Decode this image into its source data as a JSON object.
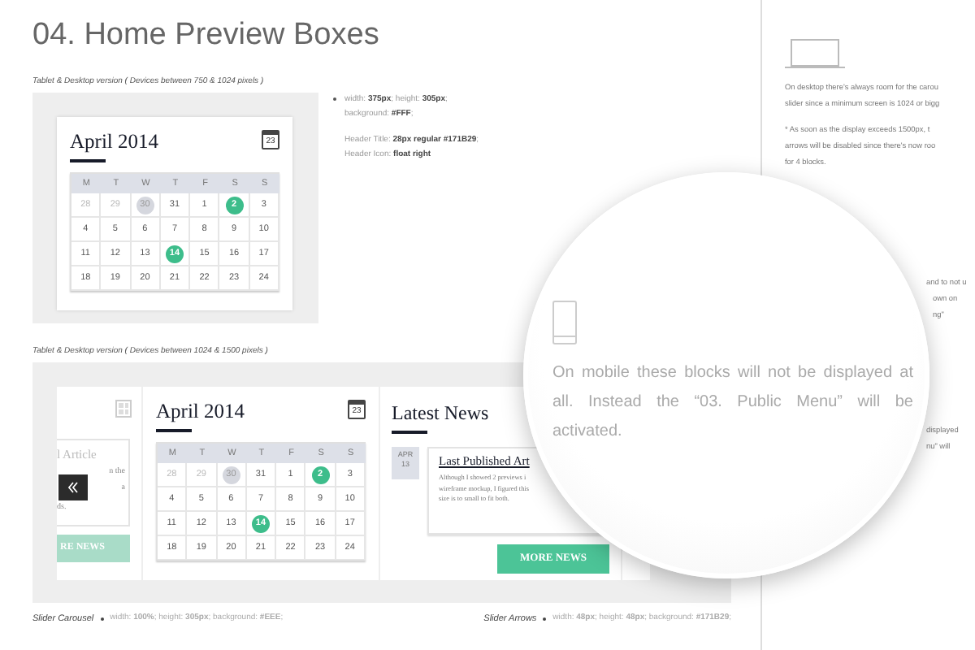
{
  "title": "04. Home Preview Boxes",
  "tablet_section": {
    "caption": "Tablet & Desktop version ( Devices between 750 & 1024 pixels )",
    "calendar": {
      "title": "April 2014",
      "icon_label": "23",
      "weekdays": [
        "M",
        "T",
        "W",
        "T",
        "F",
        "S",
        "S"
      ],
      "weeks": [
        [
          {
            "label": "28",
            "kind": "faded"
          },
          {
            "label": "29",
            "kind": "faded"
          },
          {
            "label": "30",
            "kind": "circled"
          },
          {
            "label": "31",
            "kind": "plain"
          },
          {
            "label": "1",
            "kind": "plain"
          },
          {
            "label": "2",
            "kind": "highlighted"
          },
          {
            "label": "3",
            "kind": "plain"
          }
        ],
        [
          {
            "label": "4",
            "kind": "plain"
          },
          {
            "label": "5",
            "kind": "plain"
          },
          {
            "label": "6",
            "kind": "plain"
          },
          {
            "label": "7",
            "kind": "plain"
          },
          {
            "label": "8",
            "kind": "plain"
          },
          {
            "label": "9",
            "kind": "plain"
          },
          {
            "label": "10",
            "kind": "plain"
          }
        ],
        [
          {
            "label": "11",
            "kind": "plain"
          },
          {
            "label": "12",
            "kind": "plain"
          },
          {
            "label": "13",
            "kind": "plain"
          },
          {
            "label": "14",
            "kind": "highlighted"
          },
          {
            "label": "15",
            "kind": "plain"
          },
          {
            "label": "16",
            "kind": "plain"
          },
          {
            "label": "17",
            "kind": "plain"
          }
        ],
        [
          {
            "label": "18",
            "kind": "plain"
          },
          {
            "label": "19",
            "kind": "plain"
          },
          {
            "label": "20",
            "kind": "plain"
          },
          {
            "label": "21",
            "kind": "plain"
          },
          {
            "label": "22",
            "kind": "plain"
          },
          {
            "label": "23",
            "kind": "plain"
          },
          {
            "label": "24",
            "kind": "plain"
          }
        ]
      ]
    },
    "specs": [
      {
        "lines": [
          "width: **375px**; height: **305px**;",
          "background: **#FFF**;"
        ],
        "bullet": true
      },
      {
        "lines": [
          "Header Title: **28px regular #171B29**;",
          "Header Icon: **float right**"
        ],
        "bullet": false
      }
    ]
  },
  "desktop_section": {
    "caption": "Tablet & Desktop version ( Devices between 1024 & 1500 pixels )",
    "article_card": {
      "title": "l Article",
      "lines": [
        "n the",
        "a",
        "ds."
      ],
      "button": "RE NEWS"
    },
    "calendar": {
      "title": "April 2014",
      "icon_label": "23",
      "weekdays": [
        "M",
        "T",
        "W",
        "T",
        "F",
        "S",
        "S"
      ],
      "weeks": [
        [
          {
            "label": "28",
            "kind": "faded"
          },
          {
            "label": "29",
            "kind": "faded"
          },
          {
            "label": "30",
            "kind": "circled"
          },
          {
            "label": "31",
            "kind": "plain"
          },
          {
            "label": "1",
            "kind": "plain"
          },
          {
            "label": "2",
            "kind": "highlighted"
          },
          {
            "label": "3",
            "kind": "plain"
          }
        ],
        [
          {
            "label": "4",
            "kind": "plain"
          },
          {
            "label": "5",
            "kind": "plain"
          },
          {
            "label": "6",
            "kind": "plain"
          },
          {
            "label": "7",
            "kind": "plain"
          },
          {
            "label": "8",
            "kind": "plain"
          },
          {
            "label": "9",
            "kind": "plain"
          },
          {
            "label": "10",
            "kind": "plain"
          }
        ],
        [
          {
            "label": "11",
            "kind": "plain"
          },
          {
            "label": "12",
            "kind": "plain"
          },
          {
            "label": "13",
            "kind": "plain"
          },
          {
            "label": "14",
            "kind": "highlighted"
          },
          {
            "label": "15",
            "kind": "plain"
          },
          {
            "label": "16",
            "kind": "plain"
          },
          {
            "label": "17",
            "kind": "plain"
          }
        ],
        [
          {
            "label": "18",
            "kind": "plain"
          },
          {
            "label": "19",
            "kind": "plain"
          },
          {
            "label": "20",
            "kind": "plain"
          },
          {
            "label": "21",
            "kind": "plain"
          },
          {
            "label": "22",
            "kind": "plain"
          },
          {
            "label": "23",
            "kind": "plain"
          },
          {
            "label": "24",
            "kind": "plain"
          }
        ]
      ]
    },
    "news": {
      "title": "Latest News",
      "month": "APR",
      "day": "13",
      "article_title": "Last Published Art",
      "body": [
        "Although I showed 2 previews i",
        "wireframe mockup, I figured this",
        "size is to small to fit both."
      ],
      "button": "MORE NEWS"
    },
    "notes": [
      {
        "name": "Slider Carousel",
        "spec": "width: **100%**; height: **305px**; background: **#EEE**;"
      },
      {
        "name": "Slider Arrows",
        "spec": "width: **48px**; height: **48px**; background: **#171B29**;"
      }
    ]
  },
  "side_notes": {
    "desktop_lines": [
      "On desktop there's always room for the carou",
      "slider since a minimum screen is 1024 or bigg"
    ],
    "extra_lines": [
      "* As soon as the display exceeds 1500px, t",
      "arrows will be disabled since there's now roo",
      "for 4 blocks."
    ],
    "fragments_a": [
      "and to not u",
      "own on",
      "ng\""
    ],
    "fragments_b": [
      "displayed",
      "nu\"  will"
    ]
  },
  "magnifier": {
    "text": "On mobile these blocks will not be displayed at all. Instead the “03. Public Menu” will be activated."
  }
}
